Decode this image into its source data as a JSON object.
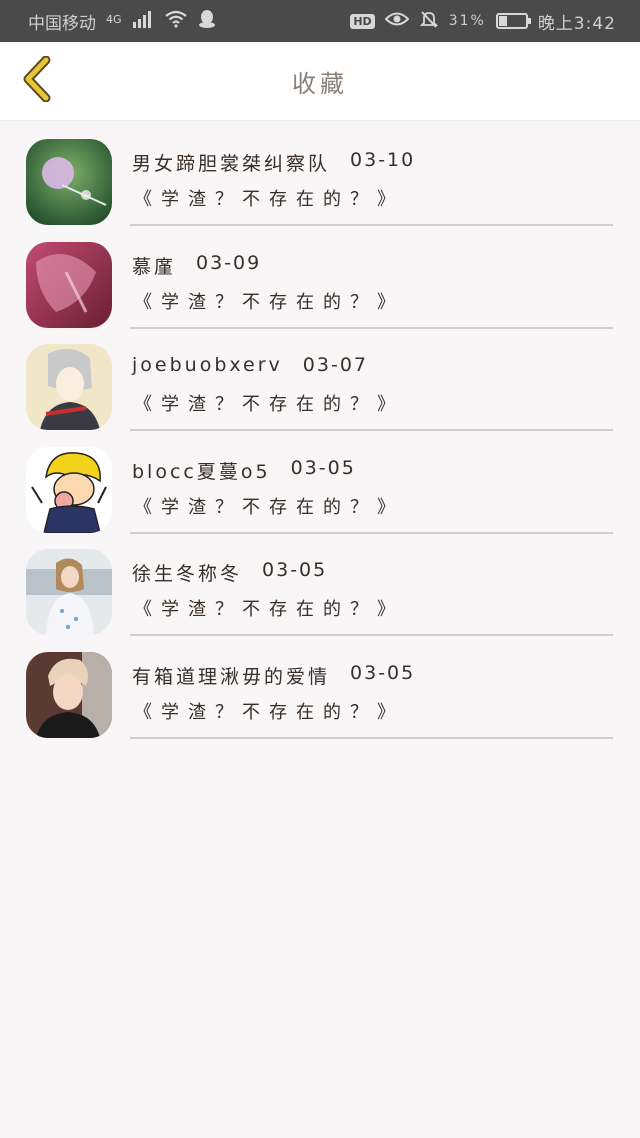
{
  "status_bar": {
    "carrier": "中国移动",
    "network": "4G",
    "battery": "31%",
    "time": "晚上3:42"
  },
  "header": {
    "title": "收藏"
  },
  "favorites": [
    {
      "name": "男女蹄胆裳桀纠察队",
      "date": "03-10",
      "title": "《学渣？不存在的？》"
    },
    {
      "name": "慕廑",
      "date": "03-09",
      "title": "《学渣？不存在的？》"
    },
    {
      "name": "joebuobxerv",
      "date": "03-07",
      "title": "《学渣？不存在的？》"
    },
    {
      "name": "blocc夏蔓o5",
      "date": "03-05",
      "title": "《学渣？不存在的？》"
    },
    {
      "name": "徐生冬称冬",
      "date": "03-05",
      "title": "《学渣？不存在的？》"
    },
    {
      "name": "有箱道理湫毋的爱情",
      "date": "03-05",
      "title": "《学渣？不存在的？》"
    }
  ],
  "colors": {
    "accent": "#e8c63a",
    "status_bar": "#4a4a4a",
    "background": "#f8f6f7",
    "divider": "#cfcfcf"
  }
}
